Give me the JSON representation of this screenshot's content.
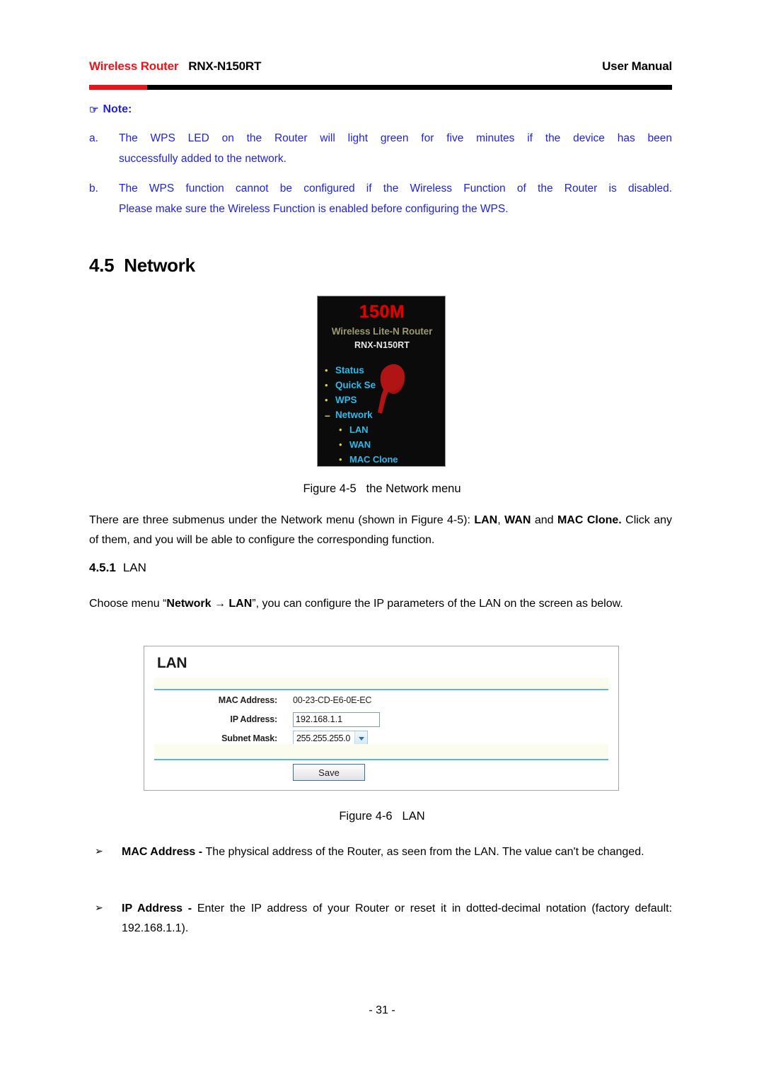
{
  "header": {
    "brand": "Wireless Router",
    "model": "RNX-N150RT",
    "doc_type": "User Manual",
    "brand_color": "#e8161b",
    "rule_color": "#000000"
  },
  "note": {
    "hand_icon": "☞",
    "title": "Note:",
    "color": "#2222dd",
    "items": [
      {
        "marker": "a.",
        "line1": "The WPS LED on the Router will light green for five minutes if the device has been",
        "line2": "successfully added to the network."
      },
      {
        "marker": "b.",
        "line1": "The WPS function cannot be configured if the Wireless Function of the Router is disabled.",
        "line2": "Please make sure the Wireless Function is enabled before configuring the WPS."
      }
    ]
  },
  "section": {
    "number": "4.5",
    "title": "Network"
  },
  "menu_figure": {
    "badge": "150M",
    "badge_color": "#e00000",
    "subtitle": "Wireless Lite-N Router",
    "subtitle_color": "#9a9a6e",
    "model": "RNX-N150RT",
    "model_color": "#e8e8e8",
    "background_color": "#0b0b0b",
    "item_color": "#2fb9e8",
    "bullet_color": "#d8d83a",
    "cursor_color": "#b01414",
    "items": [
      {
        "bullet": "•",
        "label": "Status",
        "indent": false
      },
      {
        "bullet": "•",
        "label": "Quick Se",
        "indent": false
      },
      {
        "bullet": "•",
        "label": "WPS",
        "indent": false
      },
      {
        "bullet": "–",
        "label": "Network",
        "indent": false
      },
      {
        "bullet": "•",
        "label": "LAN",
        "indent": true
      },
      {
        "bullet": "•",
        "label": "WAN",
        "indent": true
      },
      {
        "bullet": "•",
        "label": "MAC Clone",
        "indent": true
      }
    ]
  },
  "figure_45_caption": {
    "label": "Figure 4-5",
    "text": "the Network menu"
  },
  "paragraph1": {
    "part1": "There are three submenus under the Network menu (shown in Figure 4-5): ",
    "bold1": "LAN",
    "part2": ", ",
    "bold2": "WAN",
    "part3": " and ",
    "bold3": "MAC Clone.",
    "part4": " Click any of them, and you will be able to configure the corresponding function."
  },
  "subsection": {
    "number": "4.5.1",
    "title": "LAN"
  },
  "paragraph2": {
    "part1": "Choose menu “",
    "bold1": "Network → LAN",
    "part2": "”, you can configure the IP parameters of the LAN on the screen as below."
  },
  "lan_panel": {
    "title": "LAN",
    "rule_color": "#5bb6dc",
    "rows": [
      {
        "label": "MAC Address:",
        "value": "00-23-CD-E6-0E-EC",
        "type": "text"
      },
      {
        "label": "IP Address:",
        "value": "192.168.1.1",
        "type": "input"
      },
      {
        "label": "Subnet Mask:",
        "value": "255.255.255.0",
        "type": "select"
      }
    ],
    "save_label": "Save"
  },
  "figure_46_caption": {
    "label": "Figure 4-6",
    "text": "LAN"
  },
  "bullets": [
    {
      "marker": "➢",
      "bold": "MAC Address",
      "dash": " - ",
      "text": "The physical address of the Router, as seen from the LAN. The value can't be changed."
    },
    {
      "marker": "➢",
      "bold": "IP Address",
      "dash": " - ",
      "text": "Enter the IP address of your Router or reset it in dotted-decimal notation (factory default: 192.168.1.1)."
    }
  ],
  "footer": {
    "page": "- 31 -"
  }
}
